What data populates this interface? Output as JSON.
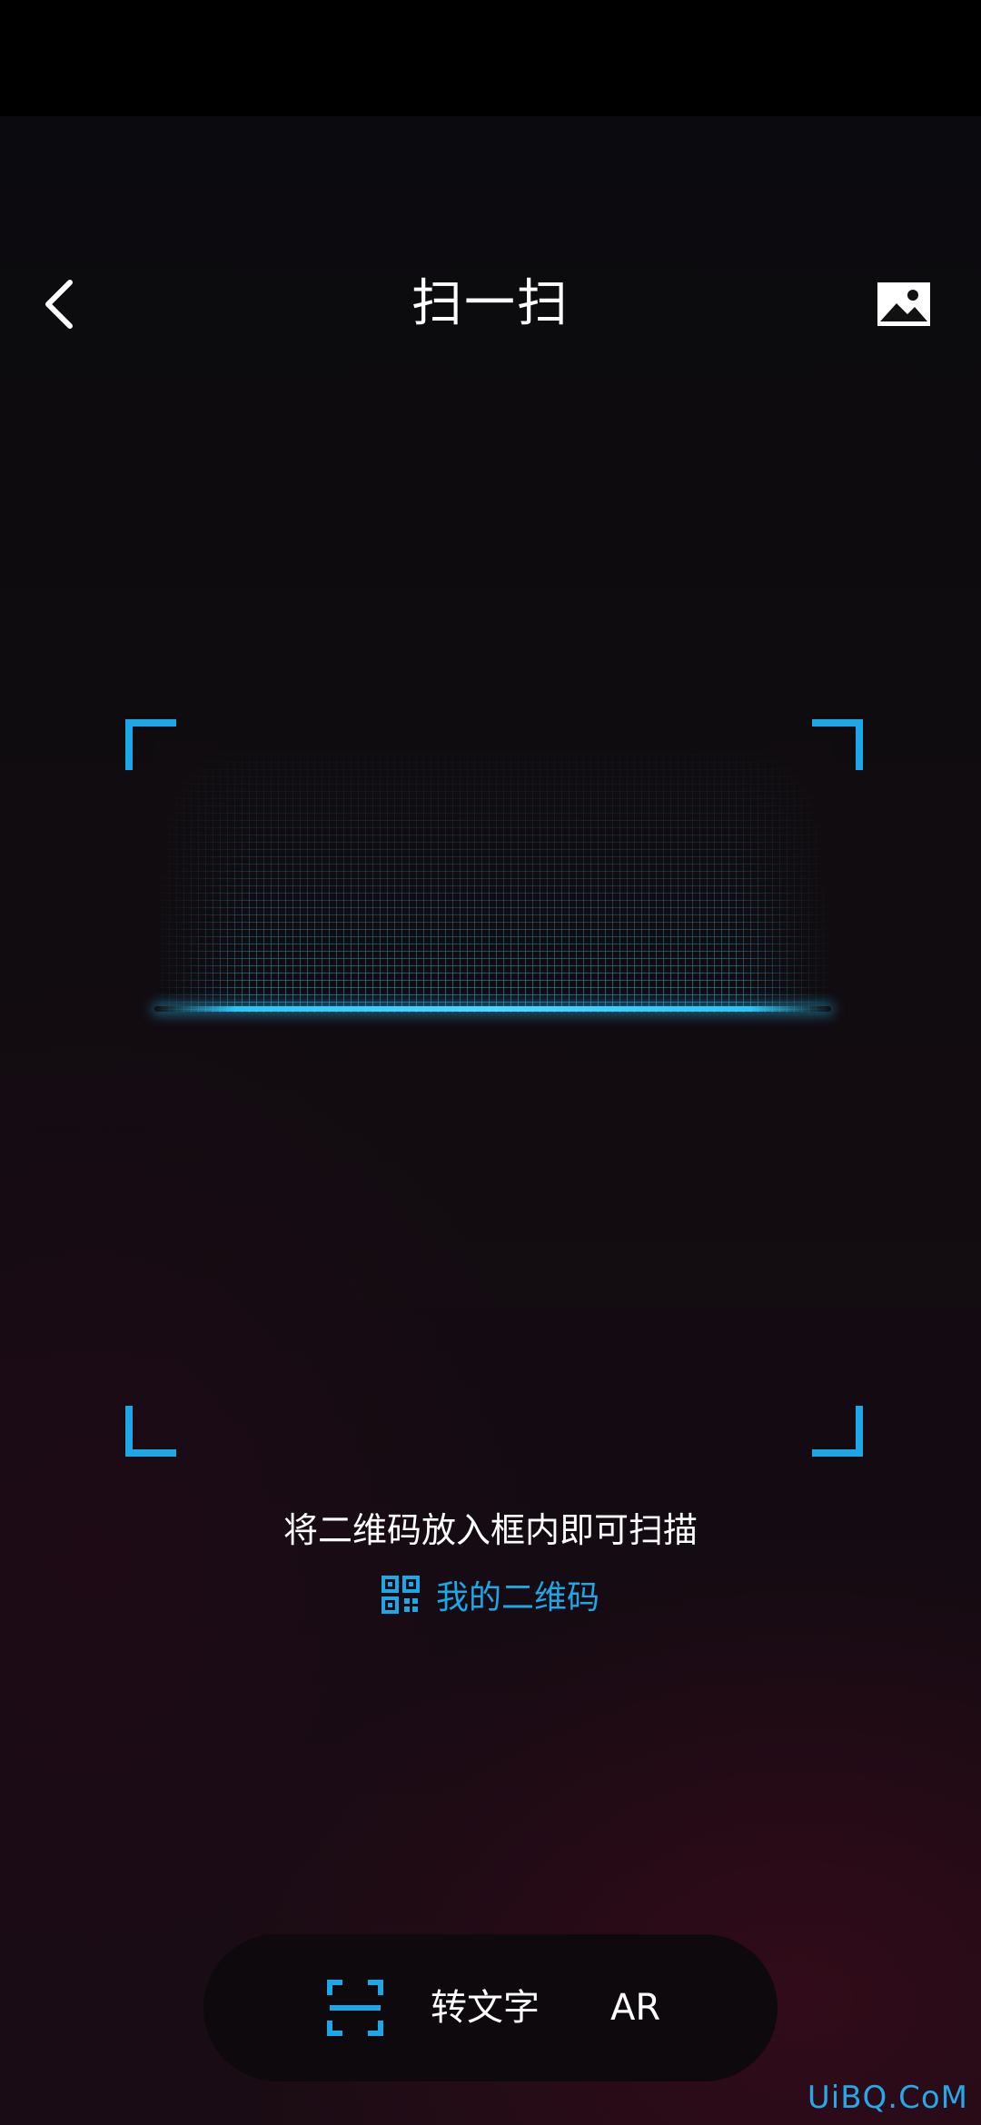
{
  "header": {
    "title": "扫一扫",
    "back_icon": "chevron-left-icon",
    "gallery_icon": "image-gallery-icon"
  },
  "scanner": {
    "hint": "将二维码放入框内即可扫描",
    "my_qr_label": "我的二维码",
    "my_qr_icon": "qr-code-icon",
    "accent_color": "#1EA7E6"
  },
  "mode_bar": {
    "active_mode_icon": "scan-frame-icon",
    "text_mode_label": "转文字",
    "ar_mode_label": "AR"
  },
  "watermark": {
    "text": "UiBQ.CoM"
  }
}
